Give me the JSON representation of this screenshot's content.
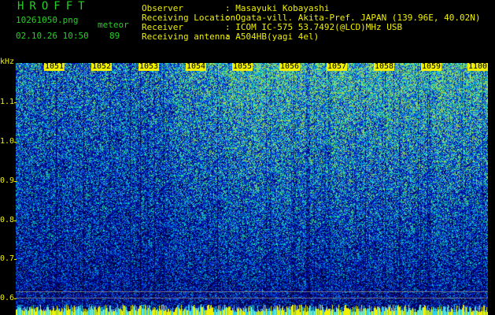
{
  "header": {
    "logo": "HROFFT",
    "filename": "10261050.png",
    "mode": "meteor",
    "datetime": "02.10.26 10:50",
    "count": "89"
  },
  "info": {
    "observer_label": "Observer",
    "observer_value": ": Masayuki Kobayashi",
    "location_label": "Receiving Location",
    "location_value": ": Ogata-vill. Akita-Pref. JAPAN (139.96E, 40.02N)",
    "receiver_label": "Receiver",
    "receiver_value": ": ICOM IC-575 53.7492(@LCD)MHz USB",
    "antenna_label": "Receiving antenna",
    "antenna_value": ": A504HB(yagi 4el)"
  },
  "axis": {
    "y_unit": "kHz",
    "y_ticks": [
      "1.1",
      "1.0",
      "0.9",
      "0.8",
      "0.7",
      "0.6"
    ],
    "x_ticks": [
      "1051",
      "1052",
      "1053",
      "1054",
      "1055",
      "1056",
      "1057",
      "1058",
      "1059",
      "1100"
    ]
  },
  "colors": {
    "background": "#000000",
    "label_green": "#22d222",
    "label_yellow": "#f0f000"
  }
}
